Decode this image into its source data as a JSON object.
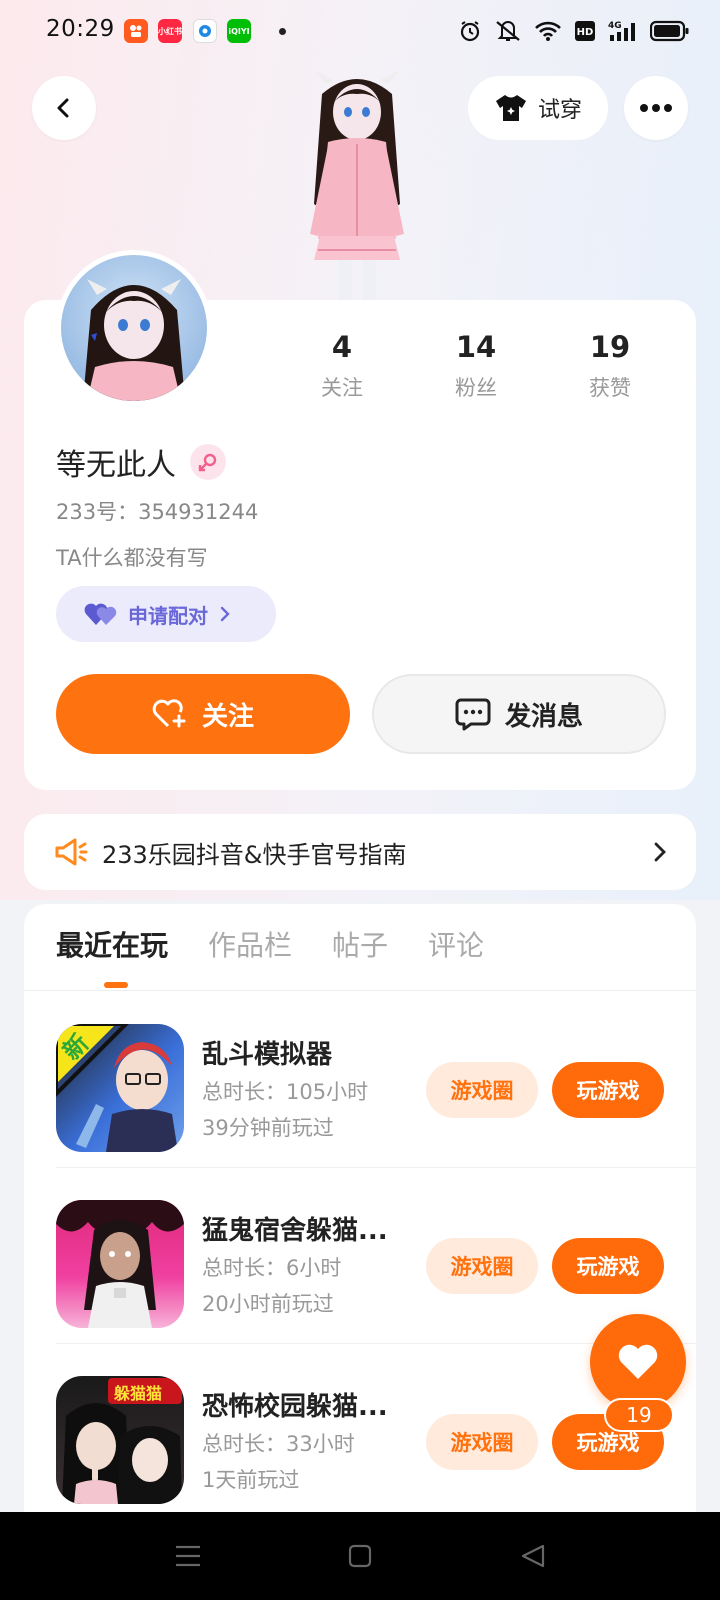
{
  "status_bar": {
    "time": "20:29",
    "notif_apps": [
      "kuaishou-app",
      "xiaohongshu-app",
      "browser-app",
      "iqiyi-app"
    ],
    "notif_labels": [
      "",
      "小红书",
      "",
      "iQIYI"
    ],
    "indicators": [
      "alarm-icon",
      "mute-icon",
      "wifi-icon",
      "hd-icon",
      "4g-signal-icon",
      "battery-icon"
    ]
  },
  "top_bar": {
    "try_on_label": "试穿"
  },
  "profile": {
    "stats": [
      {
        "value": "4",
        "label": "关注"
      },
      {
        "value": "14",
        "label": "粉丝"
      },
      {
        "value": "19",
        "label": "获赞"
      }
    ],
    "username": "等无此人",
    "gender": "female",
    "uid": "233号：354931244",
    "bio": "TA什么都没有写",
    "pair_label": "申请配对",
    "follow_label": "关注",
    "message_label": "发消息"
  },
  "notice": {
    "text": "233乐园抖音&快手官号指南"
  },
  "tabs": [
    {
      "label": "最近在玩",
      "active": true
    },
    {
      "label": "作品栏",
      "active": false
    },
    {
      "label": "帖子",
      "active": false
    },
    {
      "label": "评论",
      "active": false
    }
  ],
  "games": [
    {
      "title": "乱斗模拟器",
      "duration": "总时长：105小时",
      "last_played": "39分钟前玩过",
      "badge": "新",
      "circle_label": "游戏圈",
      "play_label": "玩游戏"
    },
    {
      "title": "猛鬼宿舍躲猫...",
      "duration": "总时长：6小时",
      "last_played": "20小时前玩过",
      "badge": "",
      "circle_label": "游戏圈",
      "play_label": "玩游戏"
    },
    {
      "title": "恐怖校园躲猫...",
      "duration": "总时长：33小时",
      "last_played": "1天前玩过",
      "badge": "躲猫猫",
      "circle_label": "游戏圈",
      "play_label": "玩游戏"
    }
  ],
  "floating": {
    "like_count": "19"
  },
  "colors": {
    "accent": "#ff7210",
    "pair": "#6a68d8"
  }
}
